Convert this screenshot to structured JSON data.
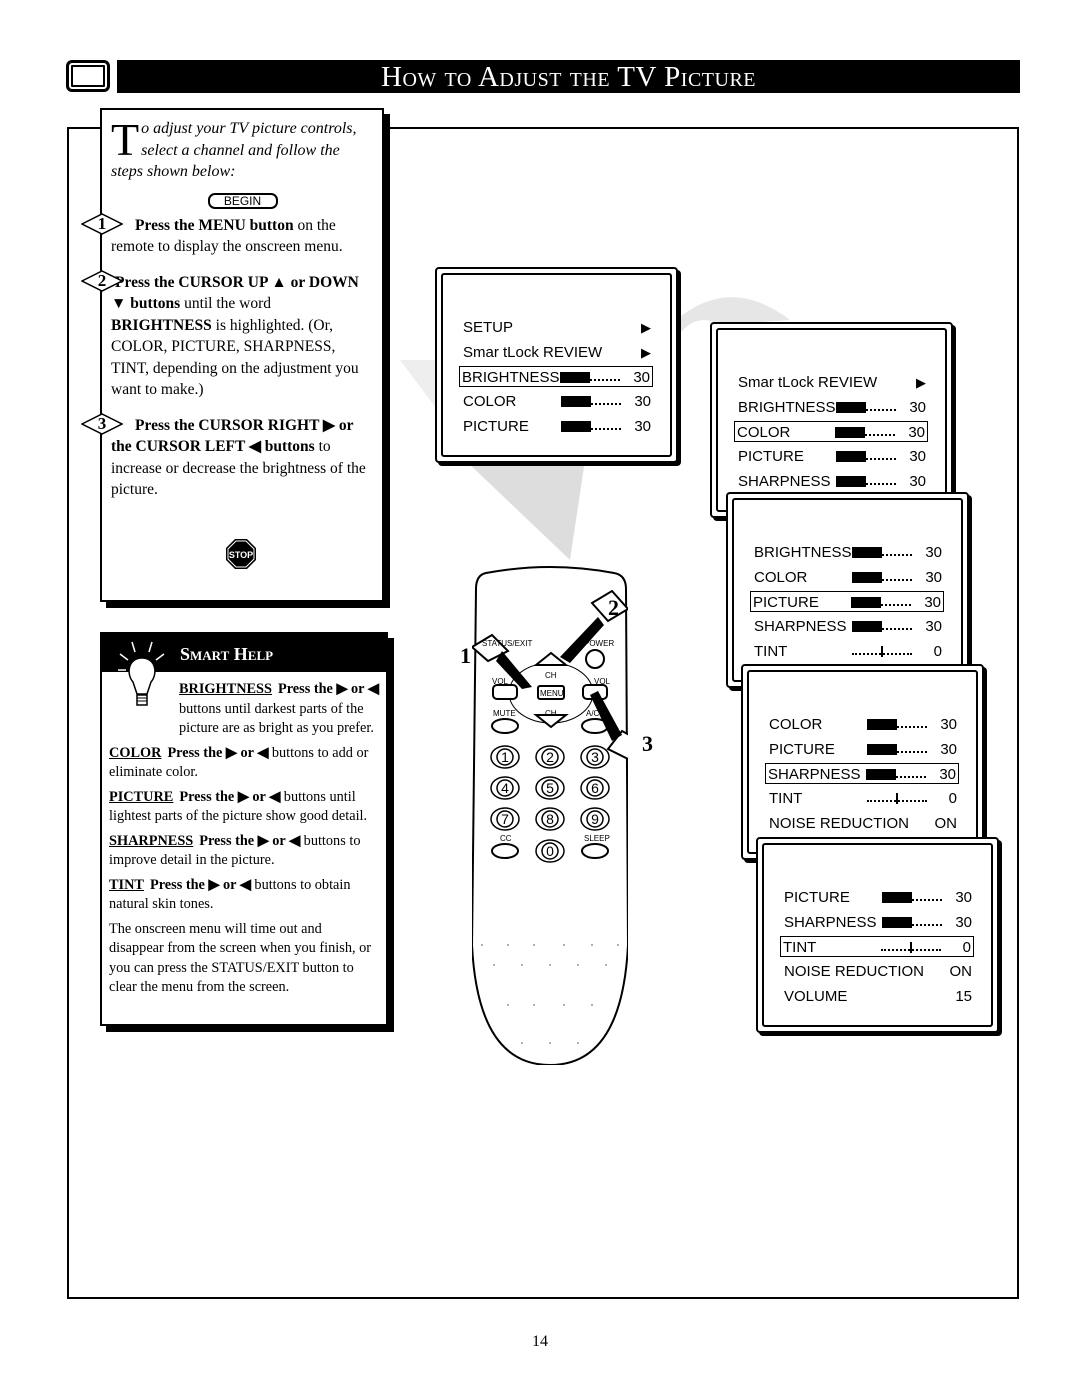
{
  "header": {
    "title": "How to Adjust the TV Picture"
  },
  "intro": {
    "dropcap": "T",
    "lead": "o adjust your TV picture controls, select a channel and follow the steps shown below:",
    "begin": "BEGIN",
    "steps": [
      {
        "num": "1",
        "bold": "Press the MENU button",
        "text": " on the remote to display the onscreen menu."
      },
      {
        "num": "2",
        "bold": "Press the CURSOR UP ▲ or DOWN ▼ buttons",
        "text": " until the word ",
        "bold2": "BRIGHTNESS",
        "text2": " is highlighted. (Or, COLOR, PICTURE, SHARPNESS, TINT, depending on the adjustment you want to make.)"
      },
      {
        "num": "3",
        "bold": "Press the CURSOR RIGHT ▶ or the CURSOR LEFT ◀ buttons",
        "text": " to increase or decrease the brightness of the picture."
      }
    ],
    "stop": "STOP"
  },
  "help": {
    "title": "Smart Help",
    "items": [
      {
        "term": "BRIGHTNESS",
        "bold": "Press the ▶ or ◀",
        "text": " buttons until darkest parts of the picture are as bright as you prefer."
      },
      {
        "term": "COLOR",
        "bold": "Press the ▶ or ◀",
        "text": " buttons to add or eliminate color."
      },
      {
        "term": "PICTURE",
        "bold": "Press the ▶ or ◀",
        "text": " buttons until lightest parts of the picture show good detail."
      },
      {
        "term": "SHARPNESS",
        "bold": "Press the ▶ or ◀",
        "text": " buttons to improve detail in the picture."
      },
      {
        "term": "TINT",
        "bold": "Press the ▶ or ◀",
        "text": " buttons to obtain natural skin tones."
      }
    ],
    "note": "The onscreen menu will time out and disappear from the screen when you finish, or you can press the STATUS/EXIT button to clear the menu from the screen."
  },
  "menus": [
    {
      "highlight": 2,
      "rows": [
        {
          "label": "SETUP",
          "arrow": "▶"
        },
        {
          "label": "Smar tLock REVIEW",
          "arrow": "▶"
        },
        {
          "label": "BRIGHTNESS",
          "value": "30",
          "bar": "level"
        },
        {
          "label": "COLOR",
          "value": "30",
          "bar": "level"
        },
        {
          "label": "PICTURE",
          "value": "30",
          "bar": "level"
        }
      ]
    },
    {
      "highlight": 2,
      "rows": [
        {
          "label": "Smar tLock REVIEW",
          "arrow": "▶"
        },
        {
          "label": "BRIGHTNESS",
          "value": "30",
          "bar": "level"
        },
        {
          "label": "COLOR",
          "value": "30",
          "bar": "level"
        },
        {
          "label": "PICTURE",
          "value": "30",
          "bar": "level"
        },
        {
          "label": "SHARPNESS",
          "value": "30",
          "bar": "level"
        }
      ]
    },
    {
      "highlight": 2,
      "rows": [
        {
          "label": "BRIGHTNESS",
          "value": "30",
          "bar": "level"
        },
        {
          "label": "COLOR",
          "value": "30",
          "bar": "level"
        },
        {
          "label": "PICTURE",
          "value": "30",
          "bar": "level"
        },
        {
          "label": "SHARPNESS",
          "value": "30",
          "bar": "level"
        },
        {
          "label": "TINT",
          "value": "0",
          "bar": "center"
        }
      ]
    },
    {
      "highlight": 2,
      "rows": [
        {
          "label": "COLOR",
          "value": "30",
          "bar": "level"
        },
        {
          "label": "PICTURE",
          "value": "30",
          "bar": "level"
        },
        {
          "label": "SHARPNESS",
          "value": "30",
          "bar": "level"
        },
        {
          "label": "TINT",
          "value": "0",
          "bar": "center"
        },
        {
          "label": "NOISE REDUCTION",
          "value": "ON"
        }
      ]
    },
    {
      "highlight": 2,
      "rows": [
        {
          "label": "PICTURE",
          "value": "30",
          "bar": "level"
        },
        {
          "label": "SHARPNESS",
          "value": "30",
          "bar": "level"
        },
        {
          "label": "TINT",
          "value": "0",
          "bar": "center"
        },
        {
          "label": "NOISE REDUCTION",
          "value": "ON"
        },
        {
          "label": "VOLUME",
          "value": "15"
        }
      ]
    }
  ],
  "remote": {
    "labels": {
      "status": "STATUS/EXIT",
      "power": "POWER",
      "ch": "CH",
      "vol": "VOL",
      "vol_left": "VOL",
      "menu": "MENU",
      "mute": "MUTE",
      "ach": "A/CH",
      "cc": "CC",
      "sleep": "SLEEP"
    },
    "digits": [
      "1",
      "2",
      "3",
      "4",
      "5",
      "6",
      "7",
      "8",
      "9",
      "0"
    ],
    "callouts": [
      "1",
      "2",
      "3"
    ]
  },
  "page_number": "14"
}
